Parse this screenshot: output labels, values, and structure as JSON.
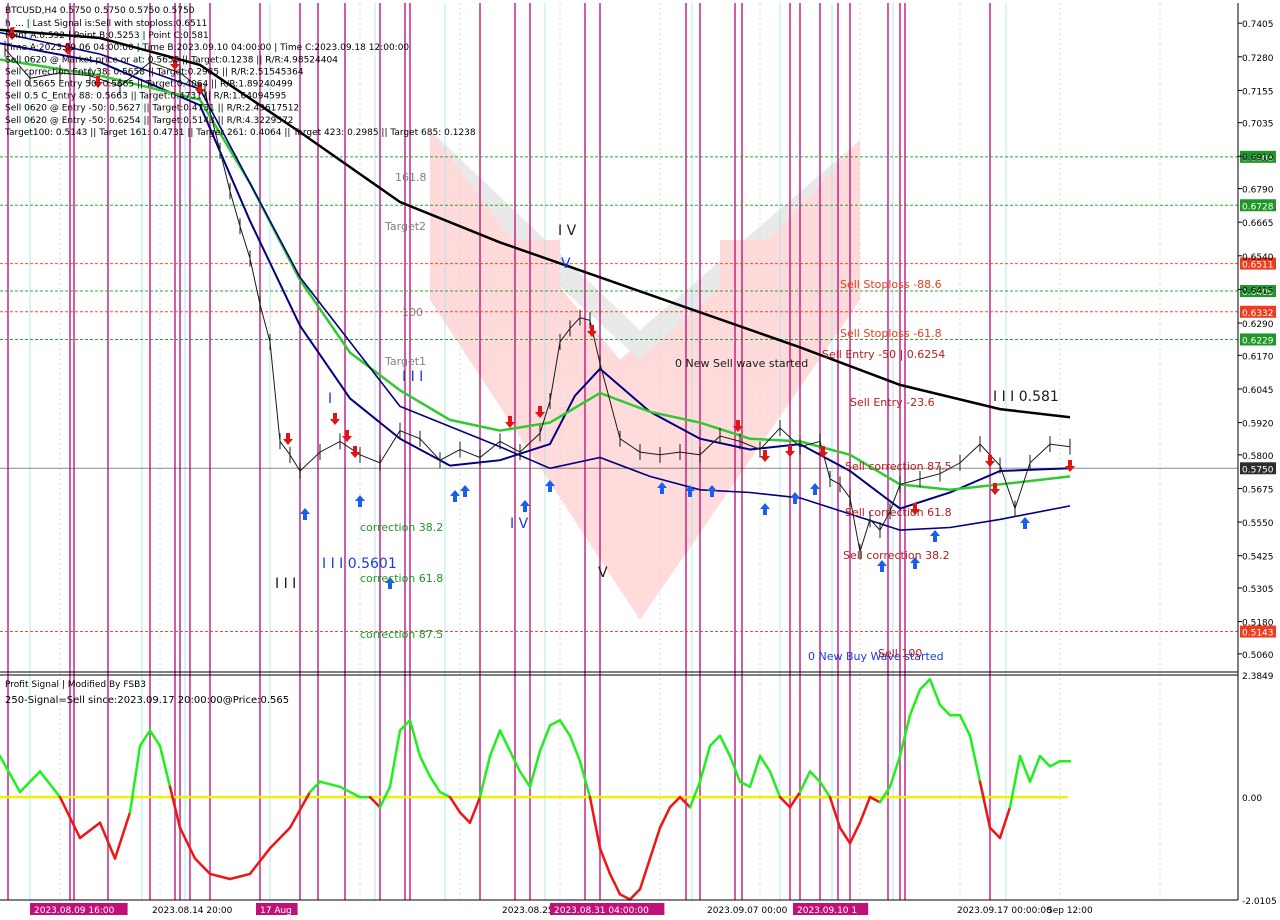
{
  "header": {
    "symbol_line": "BTCUSD,H4 0.5750 0.5750 0.5750 0.5750",
    "info_lines": [
      "h_... | Last Signal is:Sell with stoploss:0.6511",
      "Point A:0.592 | Point B:0.5253 | Point C:0.581",
      "Time A:2023.09.06 04:00:00 | Time B:2023.09.10 04:00:00 | Time C:2023.09.18 12:00:00",
      "Sell 0620 @ Market price or at: 0.5658 || Target:0.1238 || R/R:4.98524404",
      "Sell correction Entry38: 0.5658 || Target:0.2985 || R/R:2.51545364",
      "Sell 0.5665 Entry 50: 0.5665 || Target:0.4064 || R/R:1.89240499",
      "Sell 0.5 C_Entry 88: 0.5663 || Target:0.4731 || R/R:1.64094595",
      "Sell 0620 @ Entry -50: 0.5627 || Target:0.4731 || R/R:2.43617512",
      "Sell 0620 @ Entry -50: 0.6254 || Target:0.5143 || R/R:4.3229572",
      "Target100: 0.5143 || Target 161: 0.4731 || Target 261: 0.4064 || Target 423: 0.2985 || Target 685: 0.1238"
    ]
  },
  "indicator_header": {
    "title": "Profit Signal | Modified By FSB3",
    "signal_line": "250-Signal=Sell since:2023.09.17 20:00:00@Price:0.565"
  },
  "colors": {
    "background": "#ffffff",
    "grid": "#d8d8d8",
    "signal_line_magenta": "#c0107a",
    "signal_line_cyan": "#a8e4ec",
    "ma_black": "#000000",
    "ma_navy": "#000080",
    "ma_green": "#32c832",
    "stoploss_box": "#f03c1e",
    "target_box": "#1e9628",
    "price_box": "#2d2d2d",
    "buy_arrow": "#1a5ef0",
    "sell_arrow": "#e01414",
    "osc_green": "#1ef01e",
    "osc_red": "#f01414",
    "osc_zero": "#f0f000"
  },
  "price_axis": {
    "labels": [
      "0.7405",
      "0.7280",
      "0.7155",
      "0.7035",
      "0.6910",
      "0.6790",
      "0.6665",
      "0.6540",
      "0.6415",
      "0.6290",
      "0.6170",
      "0.6045",
      "0.5920",
      "0.5800",
      "0.5675",
      "0.5550",
      "0.5425",
      "0.5305",
      "0.5180",
      "0.5060"
    ]
  },
  "level_lines": [
    {
      "label": "0.6908",
      "kind": "target"
    },
    {
      "label": "0.6728",
      "kind": "target"
    },
    {
      "label": "0.6511",
      "kind": "stoploss"
    },
    {
      "label": "0.6409",
      "kind": "target"
    },
    {
      "label": "0.6332",
      "kind": "stoploss"
    },
    {
      "label": "0.6229",
      "kind": "target"
    },
    {
      "label": "0.5750",
      "kind": "price"
    },
    {
      "label": "0.5143",
      "kind": "stoploss"
    }
  ],
  "annotations": [
    {
      "text": "161.8",
      "color": "#808080"
    },
    {
      "text": "Target2",
      "color": "#808080"
    },
    {
      "text": "100",
      "color": "#808080"
    },
    {
      "text": "Target1",
      "color": "#808080"
    },
    {
      "text": "I I I",
      "color": "#1a3cdc"
    },
    {
      "text": "I",
      "color": "#1a3cdc"
    },
    {
      "text": "I V",
      "color": "#1a1a1a"
    },
    {
      "text": "V",
      "color": "#1a3cdc"
    },
    {
      "text": "I V",
      "color": "#1a3cdc"
    },
    {
      "text": "V",
      "color": "#1a1a1a"
    },
    {
      "text": "I I I",
      "color": "#1a1a1a"
    },
    {
      "text": "I I I 0.5601",
      "color": "#1a3cdc"
    },
    {
      "text": "correction 38.2",
      "color": "#1e9628"
    },
    {
      "text": "correction 61.8",
      "color": "#1e9628"
    },
    {
      "text": "correction 87.5",
      "color": "#1e9628"
    },
    {
      "text": "0 New Sell wave started",
      "color": "#1a1a1a"
    },
    {
      "text": "Sell Stoploss -88.6",
      "color": "#e0401e"
    },
    {
      "text": "Sell Stoploss -61.8",
      "color": "#e0401e"
    },
    {
      "text": "Sell Entry -50 | 0.6254",
      "color": "#b41e1e"
    },
    {
      "text": "Sell Entry -23.6",
      "color": "#b41e1e"
    },
    {
      "text": "I I I 0.581",
      "color": "#1a1a1a"
    },
    {
      "text": "Sell correction 87.5",
      "color": "#b41e1e"
    },
    {
      "text": "Sell correction 61.8",
      "color": "#b41e1e"
    },
    {
      "text": "Sell correction 38.2",
      "color": "#b41e1e"
    },
    {
      "text": "0 New Buy Wave started",
      "color": "#1a3cdc"
    },
    {
      "text": "Sell 100",
      "color": "#b41e1e"
    }
  ],
  "time_axis": {
    "labels": [
      "2023.08.09 16:00",
      "2023.08.14 20:00",
      "17 Aug",
      "2023.08.25",
      "2023.08.31 04:00:00",
      "2023.09.07 00:00",
      "2023.09.10 1",
      "2023.09.17 00:00:00",
      "Sep 12:00"
    ]
  },
  "oscillator_axis": {
    "labels": [
      "2.3849",
      "0.00",
      "-2.0105"
    ]
  },
  "chart_data": [
    {
      "type": "line",
      "title": "BTCUSD,H4",
      "ylim": [
        0.5,
        0.748
      ],
      "series": [
        {
          "name": "MA black",
          "x": [
            0,
            100,
            200,
            300,
            400,
            500,
            600,
            700,
            800,
            900,
            1000,
            1070
          ],
          "values": [
            0.738,
            0.735,
            0.725,
            0.7,
            0.674,
            0.659,
            0.646,
            0.633,
            0.62,
            0.606,
            0.597,
            0.594
          ]
        },
        {
          "name": "MA navy",
          "x": [
            0,
            100,
            200,
            250,
            300,
            350,
            400,
            450,
            500,
            550,
            575,
            600,
            650,
            700,
            750,
            800,
            850,
            900,
            950,
            1000,
            1070
          ],
          "values": [
            0.733,
            0.726,
            0.71,
            0.667,
            0.628,
            0.601,
            0.586,
            0.576,
            0.578,
            0.584,
            0.602,
            0.612,
            0.596,
            0.586,
            0.582,
            0.584,
            0.574,
            0.56,
            0.566,
            0.574,
            0.575
          ]
        },
        {
          "name": "MA green",
          "x": [
            0,
            100,
            200,
            250,
            300,
            350,
            400,
            450,
            500,
            550,
            600,
            650,
            700,
            750,
            800,
            850,
            900,
            950,
            1000,
            1070
          ],
          "values": [
            0.727,
            0.721,
            0.712,
            0.681,
            0.645,
            0.618,
            0.604,
            0.593,
            0.589,
            0.592,
            0.603,
            0.596,
            0.592,
            0.586,
            0.585,
            0.58,
            0.569,
            0.567,
            0.569,
            0.572
          ]
        },
        {
          "name": "MA navy lower",
          "x": [
            0,
            100,
            200,
            300,
            400,
            500,
            550,
            600,
            650,
            700,
            750,
            800,
            850,
            900,
            950,
            1000,
            1070
          ],
          "values": [
            0.737,
            0.729,
            0.716,
            0.646,
            0.598,
            0.583,
            0.575,
            0.579,
            0.572,
            0.567,
            0.566,
            0.564,
            0.558,
            0.552,
            0.553,
            0.556,
            0.561
          ]
        },
        {
          "name": "Price",
          "x": [
            5,
            30,
            60,
            90,
            120,
            150,
            180,
            205,
            220,
            230,
            240,
            250,
            260,
            270,
            280,
            290,
            300,
            320,
            340,
            360,
            380,
            400,
            420,
            440,
            460,
            480,
            500,
            520,
            540,
            550,
            560,
            570,
            580,
            590,
            600,
            620,
            640,
            660,
            680,
            700,
            720,
            740,
            760,
            780,
            800,
            820,
            830,
            840,
            850,
            860,
            870,
            880,
            890,
            900,
            920,
            940,
            960,
            980,
            1000,
            1015,
            1030,
            1050,
            1070
          ],
          "values": [
            0.731,
            0.72,
            0.722,
            0.721,
            0.717,
            0.726,
            0.722,
            0.715,
            0.693,
            0.678,
            0.665,
            0.653,
            0.636,
            0.622,
            0.585,
            0.58,
            0.574,
            0.581,
            0.585,
            0.58,
            0.577,
            0.589,
            0.586,
            0.578,
            0.582,
            0.579,
            0.585,
            0.581,
            0.588,
            0.6,
            0.622,
            0.627,
            0.631,
            0.63,
            0.614,
            0.586,
            0.581,
            0.58,
            0.581,
            0.58,
            0.587,
            0.585,
            0.582,
            0.59,
            0.583,
            0.585,
            0.571,
            0.569,
            0.564,
            0.544,
            0.556,
            0.552,
            0.559,
            0.569,
            0.571,
            0.573,
            0.577,
            0.584,
            0.576,
            0.56,
            0.577,
            0.584,
            0.583
          ]
        }
      ]
    },
    {
      "type": "line",
      "title": "Profit Signal | Modified By FSB3",
      "ylim": [
        -2.0105,
        2.3849
      ],
      "x": [
        0,
        20,
        40,
        60,
        80,
        100,
        115,
        130,
        140,
        150,
        160,
        170,
        180,
        195,
        210,
        230,
        250,
        270,
        290,
        310,
        320,
        340,
        360,
        370,
        380,
        390,
        400,
        410,
        420,
        430,
        440,
        450,
        460,
        470,
        480,
        490,
        500,
        510,
        520,
        530,
        540,
        550,
        560,
        570,
        580,
        590,
        600,
        610,
        620,
        630,
        640,
        650,
        660,
        670,
        680,
        690,
        700,
        710,
        720,
        730,
        740,
        750,
        760,
        770,
        780,
        790,
        800,
        810,
        820,
        830,
        840,
        850,
        860,
        870,
        880,
        890,
        900,
        910,
        920,
        930,
        940,
        950,
        960,
        970,
        980,
        990,
        1000,
        1010,
        1020,
        1030,
        1040,
        1050,
        1060,
        1070
      ],
      "series": [
        {
          "name": "Oscillator",
          "values": [
            0.8,
            0.1,
            0.5,
            0.0,
            -0.8,
            -0.5,
            -1.2,
            -0.3,
            1.0,
            1.3,
            1.0,
            0.2,
            -0.6,
            -1.2,
            -1.5,
            -1.6,
            -1.5,
            -1.0,
            -0.6,
            0.1,
            0.3,
            0.2,
            0.0,
            0.0,
            -0.2,
            0.2,
            1.3,
            1.5,
            0.8,
            0.4,
            0.1,
            0.0,
            -0.3,
            -0.5,
            0.0,
            0.8,
            1.3,
            0.9,
            0.5,
            0.2,
            0.9,
            1.4,
            1.5,
            1.2,
            0.7,
            0.0,
            -1.0,
            -1.5,
            -1.9,
            -2.0,
            -1.8,
            -1.2,
            -0.6,
            -0.2,
            0.0,
            -0.2,
            0.3,
            1.0,
            1.2,
            0.8,
            0.3,
            0.2,
            0.8,
            0.5,
            0.0,
            -0.2,
            0.1,
            0.5,
            0.3,
            0.0,
            -0.6,
            -0.9,
            -0.5,
            0.0,
            -0.1,
            0.2,
            0.8,
            1.6,
            2.1,
            2.3,
            1.8,
            1.6,
            1.6,
            1.2,
            0.3,
            -0.6,
            -0.8,
            -0.2,
            0.8,
            0.3,
            0.8,
            0.6,
            0.7,
            0.7
          ]
        }
      ]
    }
  ]
}
